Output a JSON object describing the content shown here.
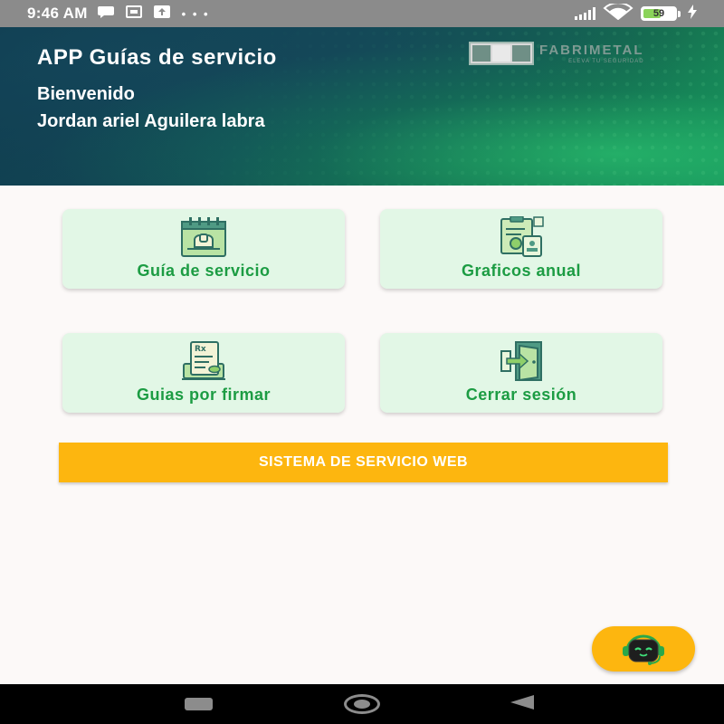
{
  "status_bar": {
    "time": "9:46 AM",
    "icons": [
      "chat-bubble-icon",
      "calendar-icon",
      "upload-icon",
      "more-dots-icon",
      "signal-icon",
      "wifi-icon",
      "battery-icon",
      "charging-icon"
    ],
    "dots": "• • •",
    "battery_level": "59",
    "battery_fraction": 0.59
  },
  "header": {
    "title": "APP Guías de servicio",
    "welcome": "Bienvenido",
    "user_name": "Jordan ariel Aguilera labra",
    "logo_text": "FABRIMETAL",
    "logo_tagline": "ELEVA TU SEGURIDAD"
  },
  "cards": [
    {
      "label": "Guía de servicio",
      "icon": "calendar-elevator-icon"
    },
    {
      "label": "Graficos anual",
      "icon": "clipboard-chart-icon"
    },
    {
      "label": "Guias por firmar",
      "icon": "prescription-document-icon"
    },
    {
      "label": "Cerrar sesión",
      "icon": "exit-door-icon"
    }
  ],
  "web_button": {
    "label": "SISTEMA DE SERVICIO WEB"
  },
  "fab": {
    "icon": "robot-assistant-icon"
  },
  "nav": {
    "icons": [
      "recent-apps-icon",
      "home-icon",
      "back-icon"
    ]
  },
  "colors": {
    "card_bg": "#e2f7e6",
    "card_text": "#1c9c43",
    "accent_yellow": "#fdb60f",
    "header_dark": "#0f3a4e",
    "header_green": "#1a9a5e"
  }
}
